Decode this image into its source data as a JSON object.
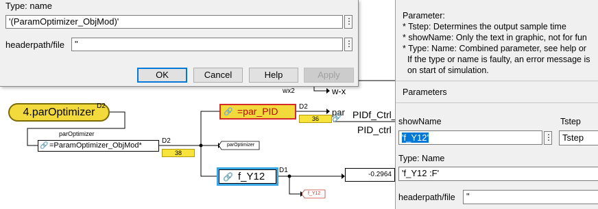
{
  "left_dialog": {
    "type_label": "Type: name",
    "type_value": "'(ParamOptimizer_ObjMod)'",
    "headerpath_label": "headerpath/file",
    "headerpath_value": "\"",
    "dots": "⋮",
    "ok": "OK",
    "cancel": "Cancel",
    "help": "Help",
    "apply": "Apply"
  },
  "right_panel": {
    "desc": [
      "Parameter:",
      "* Tstep: Determines the output sample time",
      "* showName: Only the text in graphic, not for fun",
      "* Type: Name: Combined parameter, see help or",
      "  If the type or name is faulty, an error message is",
      "  on start of simulation."
    ],
    "parameters_heading": "Parameters",
    "showname_label": "showName",
    "showname_value": "'f_Y12'",
    "tstep_label": "Tstep",
    "tstep_value": "Tstep",
    "type_label": "Type: Name",
    "type_value": "'f_Y12 :F'",
    "headerpath_label": "headerpath/file",
    "headerpath_value": "\"",
    "dots": "⋮"
  },
  "diagram": {
    "par_optimizer_block": "4.parOptimizer",
    "d2_a": "D2",
    "par_optimizer_sig": "parOptimizer",
    "objmod_block": "=ParamOptimizer_ObjMod*",
    "d2_b": "D2",
    "val_38": "38",
    "par_pid_block": "=par_PID",
    "d2_c": "D2",
    "val_36": "36",
    "wx2": "wx2",
    "w_x": "w-x",
    "par_port": "par",
    "pidf_ctrl": "PIDf_Ctrl_",
    "pid_ctrl": "PID_ctrl",
    "goto_par": "parOptimizer",
    "fy12_block": "f_Y12",
    "d1": "D1",
    "display_value": "-0.2964",
    "goto_fy12": "f_Y12"
  },
  "colors": {
    "accent": "#0078d7",
    "block_yellow": "#f2da3c",
    "block_red": "#d42a2a",
    "fy12_border": "#3aa8e6",
    "selection": "#0078d7"
  }
}
